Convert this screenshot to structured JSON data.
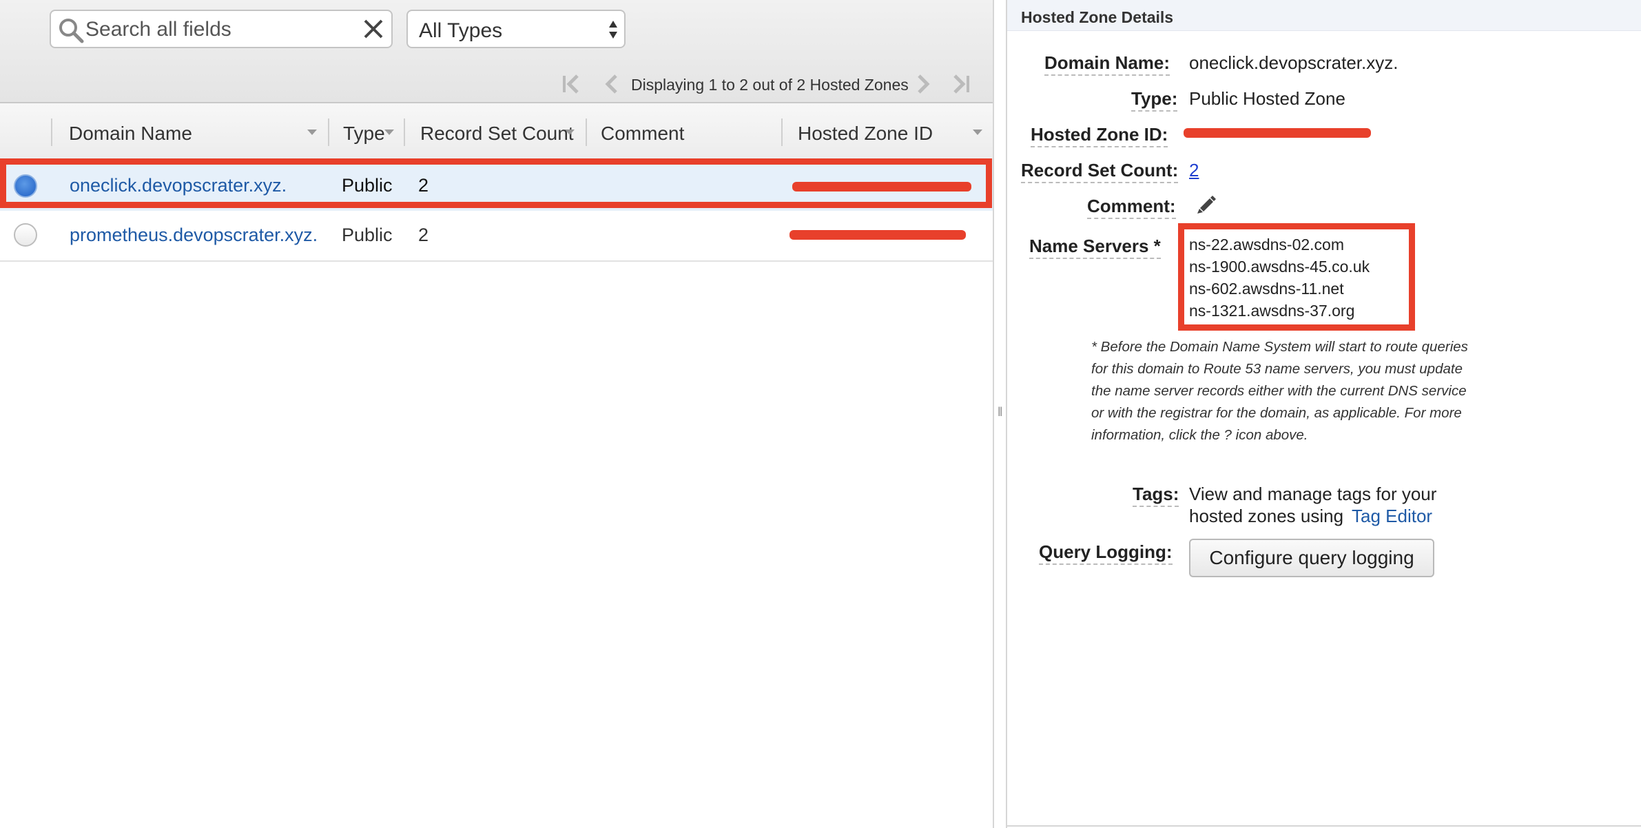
{
  "toolbar": {
    "search_placeholder": "Search all fields",
    "type_filter_value": "All Types",
    "pager_text": "Displaying 1 to 2 out of 2 Hosted Zones"
  },
  "table": {
    "columns": [
      "Domain Name",
      "Type",
      "Record Set Count",
      "Comment",
      "Hosted Zone ID"
    ],
    "rows": [
      {
        "domain_name": "oneclick.devopscrater.xyz.",
        "type": "Public",
        "record_set_count": "2",
        "comment": "",
        "selected": true
      },
      {
        "domain_name": "prometheus.devopscrater.xyz.",
        "type": "Public",
        "record_set_count": "2",
        "comment": "",
        "selected": false
      }
    ]
  },
  "details": {
    "title": "Hosted Zone Details",
    "domain_name_label": "Domain Name:",
    "domain_name_value": "oneclick.devopscrater.xyz.",
    "type_label": "Type:",
    "type_value": "Public Hosted Zone",
    "hosted_zone_id_label": "Hosted Zone ID:",
    "record_set_count_label": "Record Set Count:",
    "record_set_count_value": "2",
    "comment_label": "Comment:",
    "name_servers_label": "Name Servers *",
    "name_servers": [
      "ns-22.awsdns-02.com",
      "ns-1900.awsdns-45.co.uk",
      "ns-602.awsdns-11.net",
      "ns-1321.awsdns-37.org"
    ],
    "name_servers_note": "* Before the Domain Name System will start to route queries for this domain to Route 53 name servers, you must update the name server records either with the current DNS service or with the registrar for the domain, as applicable. For more information, click the ? icon above.",
    "tags_label": "Tags:",
    "tags_text_line1": "View and manage tags for your",
    "tags_text_line2": "hosted zones using",
    "tag_editor_link": "Tag Editor",
    "query_logging_label": "Query Logging:",
    "query_logging_button": "Configure query logging"
  },
  "colors": {
    "highlight": "#e8402b",
    "link": "#1f5aa6",
    "selected_row": "#e6f0fa"
  }
}
